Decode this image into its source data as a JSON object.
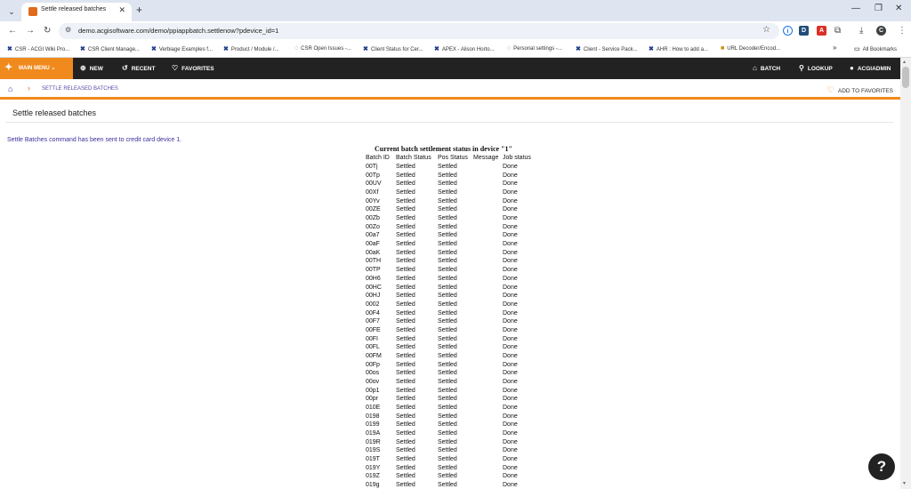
{
  "browser": {
    "tab_title": "Settle released batches",
    "url": "demo.acgisoftware.com/demo/ppiappbatch.settlenow?pdevice_id=1",
    "bookmarks": [
      "CSR - ACGI Wiki Pro...",
      "CSR Client Manage...",
      "Verbiage Examples f...",
      "Product / Module /...",
      "CSR Open Issues -...",
      "Client Status for Cer...",
      "APEX - Alison Horto...",
      "Personal settings -...",
      "Client - Service Pack...",
      "AHR : How to add a...",
      "URL Decoder/Encod..."
    ],
    "all_bookmarks": "All Bookmarks",
    "profile_initial": "C"
  },
  "app": {
    "nav": {
      "main_menu": "MAIN MENU",
      "new": "NEW",
      "recent": "RECENT",
      "favorites": "FAVORITES",
      "batch": "BATCH",
      "lookup": "LOOKUP",
      "user": "ACGIADMIN"
    },
    "breadcrumb": "SETTLE RELEASED BATCHES",
    "add_to_favorites": "ADD TO FAVORITES",
    "page_title": "Settle released batches",
    "message": "Settle Batches command has been sent to credit card device 1.",
    "table": {
      "title": "Current batch settlement status in device \"1\"",
      "headers": [
        "Batch ID",
        "Batch Status",
        "Pos Status",
        "Message",
        "Job status"
      ],
      "rows": [
        [
          "00Tj",
          "Settled",
          "Settled",
          "",
          "Done"
        ],
        [
          "00Tp",
          "Settled",
          "Settled",
          "",
          "Done"
        ],
        [
          "00UV",
          "Settled",
          "Settled",
          "",
          "Done"
        ],
        [
          "00Xf",
          "Settled",
          "Settled",
          "",
          "Done"
        ],
        [
          "00Yv",
          "Settled",
          "Settled",
          "",
          "Done"
        ],
        [
          "00ZE",
          "Settled",
          "Settled",
          "",
          "Done"
        ],
        [
          "00Zb",
          "Settled",
          "Settled",
          "",
          "Done"
        ],
        [
          "00Zo",
          "Settled",
          "Settled",
          "",
          "Done"
        ],
        [
          "00a7",
          "Settled",
          "Settled",
          "",
          "Done"
        ],
        [
          "00aF",
          "Settled",
          "Settled",
          "",
          "Done"
        ],
        [
          "00aK",
          "Settled",
          "Settled",
          "",
          "Done"
        ],
        [
          "00TH",
          "Settled",
          "Settled",
          "",
          "Done"
        ],
        [
          "00TP",
          "Settled",
          "Settled",
          "",
          "Done"
        ],
        [
          "00H6",
          "Settled",
          "Settled",
          "",
          "Done"
        ],
        [
          "00HC",
          "Settled",
          "Settled",
          "",
          "Done"
        ],
        [
          "00HJ",
          "Settled",
          "Settled",
          "",
          "Done"
        ],
        [
          "0002",
          "Settled",
          "Settled",
          "",
          "Done"
        ],
        [
          "00F4",
          "Settled",
          "Settled",
          "",
          "Done"
        ],
        [
          "00F7",
          "Settled",
          "Settled",
          "",
          "Done"
        ],
        [
          "00FE",
          "Settled",
          "Settled",
          "",
          "Done"
        ],
        [
          "00FI",
          "Settled",
          "Settled",
          "",
          "Done"
        ],
        [
          "00FL",
          "Settled",
          "Settled",
          "",
          "Done"
        ],
        [
          "00FM",
          "Settled",
          "Settled",
          "",
          "Done"
        ],
        [
          "00Fp",
          "Settled",
          "Settled",
          "",
          "Done"
        ],
        [
          "00os",
          "Settled",
          "Settled",
          "",
          "Done"
        ],
        [
          "00ov",
          "Settled",
          "Settled",
          "",
          "Done"
        ],
        [
          "00p1",
          "Settled",
          "Settled",
          "",
          "Done"
        ],
        [
          "00pr",
          "Settled",
          "Settled",
          "",
          "Done"
        ],
        [
          "010E",
          "Settled",
          "Settled",
          "",
          "Done"
        ],
        [
          "0198",
          "Settled",
          "Settled",
          "",
          "Done"
        ],
        [
          "0199",
          "Settled",
          "Settled",
          "",
          "Done"
        ],
        [
          "019A",
          "Settled",
          "Settled",
          "",
          "Done"
        ],
        [
          "019R",
          "Settled",
          "Settled",
          "",
          "Done"
        ],
        [
          "019S",
          "Settled",
          "Settled",
          "",
          "Done"
        ],
        [
          "019T",
          "Settled",
          "Settled",
          "",
          "Done"
        ],
        [
          "019Y",
          "Settled",
          "Settled",
          "",
          "Done"
        ],
        [
          "019Z",
          "Settled",
          "Settled",
          "",
          "Done"
        ],
        [
          "019g",
          "Settled",
          "Settled",
          "",
          "Done"
        ]
      ]
    }
  },
  "colors": {
    "accent": "#f08a1d",
    "nav_bg": "#222222",
    "link": "#3a2f9a"
  }
}
